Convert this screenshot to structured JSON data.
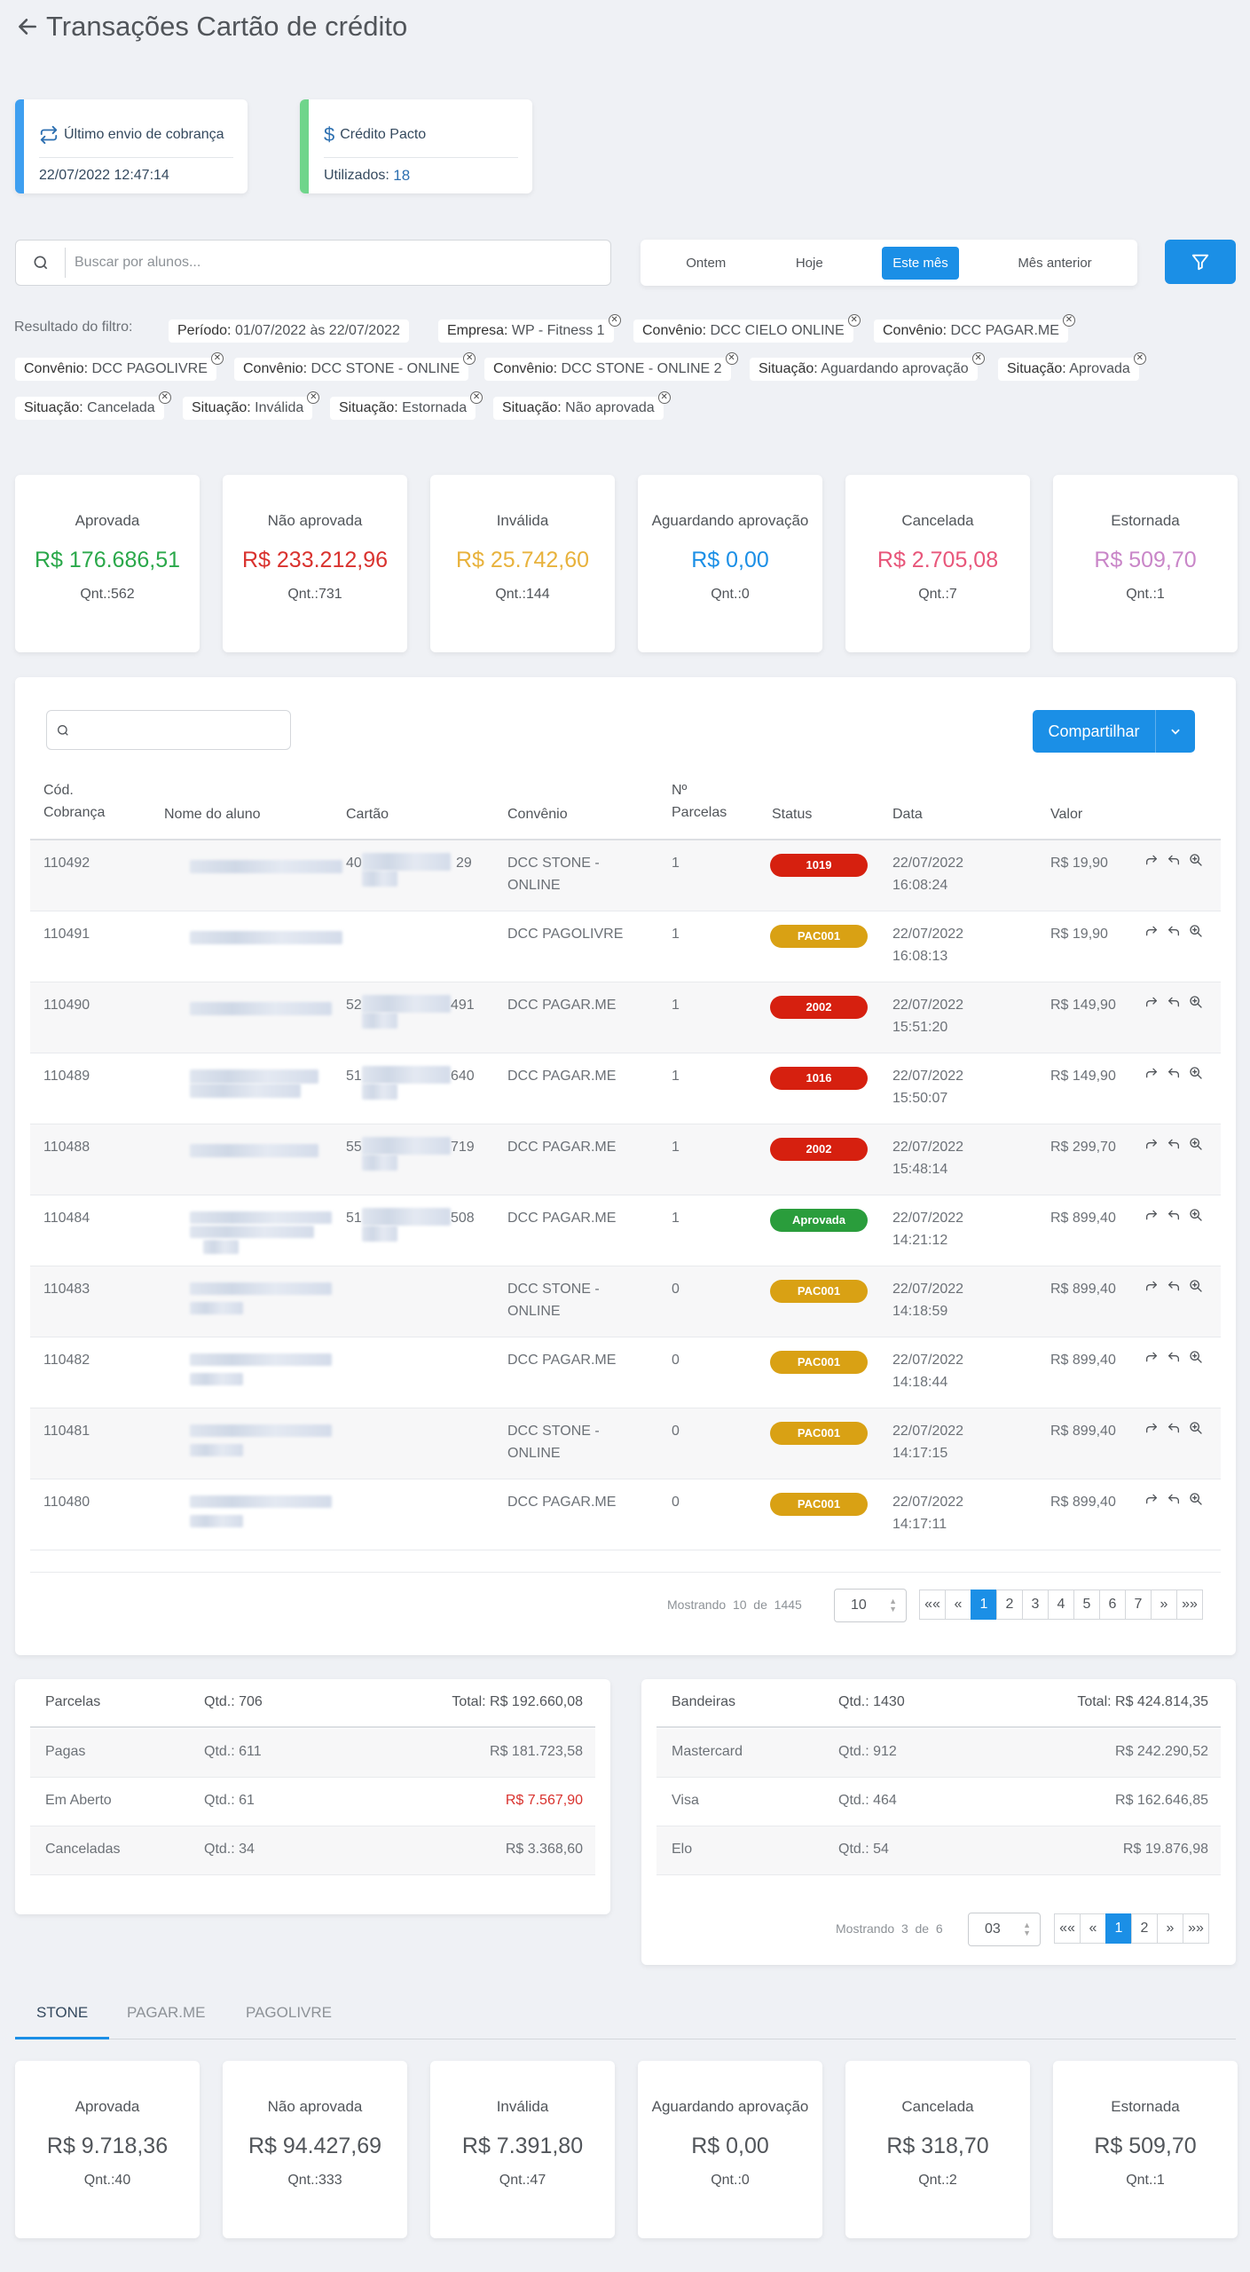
{
  "page": {
    "title": "Transações Cartão de crédito"
  },
  "info_cards": {
    "last_billing": {
      "label": "Último envio de cobrança",
      "value": "22/07/2022 12:47:14"
    },
    "credit": {
      "label": "Crédito Pacto",
      "value_label": "Utilizados:",
      "value": "18"
    }
  },
  "search": {
    "placeholder": "Buscar por alunos..."
  },
  "period": {
    "options": [
      "Ontem",
      "Hoje",
      "Este mês",
      "Mês anterior"
    ],
    "selected": "Este mês"
  },
  "filter": {
    "label": "Resultado do filtro:",
    "chips": [
      {
        "key": "Período:",
        "value": "01/07/2022 às 22/07/2022"
      },
      {
        "key": "Empresa:",
        "value": "WP - Fitness 1"
      },
      {
        "key": "Convênio:",
        "value": "DCC CIELO ONLINE"
      },
      {
        "key": "Convênio:",
        "value": "DCC PAGAR.ME"
      },
      {
        "key": "Convênio:",
        "value": "DCC PAGOLIVRE"
      },
      {
        "key": "Convênio:",
        "value": "DCC STONE - ONLINE"
      },
      {
        "key": "Convênio:",
        "value": "DCC STONE - ONLINE 2"
      },
      {
        "key": "Situação:",
        "value": "Aguardando aprovação"
      },
      {
        "key": "Situação:",
        "value": "Aprovada"
      },
      {
        "key": "Situação:",
        "value": "Cancelada"
      },
      {
        "key": "Situação:",
        "value": "Inválida"
      },
      {
        "key": "Situação:",
        "value": "Estornada"
      },
      {
        "key": "Situação:",
        "value": "Não aprovada"
      }
    ]
  },
  "stats": [
    {
      "label": "Aprovada",
      "value": "R$ 176.686,51",
      "qty": "Qnt.:562",
      "color": "#2aa84a"
    },
    {
      "label": "Não aprovada",
      "value": "R$ 233.212,96",
      "qty": "Qnt.:731",
      "color": "#d9322e"
    },
    {
      "label": "Inválida",
      "value": "R$ 25.742,60",
      "qty": "Qnt.:144",
      "color": "#e8b23c"
    },
    {
      "label": "Aguardando aprovação",
      "value": "R$ 0,00",
      "qty": "Qnt.:0",
      "color": "#1b8fe6"
    },
    {
      "label": "Cancelada",
      "value": "R$ 2.705,08",
      "qty": "Qnt.:7",
      "color": "#e8567a"
    },
    {
      "label": "Estornada",
      "value": "R$ 509,70",
      "qty": "Qnt.:1",
      "color": "#c986c8"
    }
  ],
  "table": {
    "share_label": "Compartilhar",
    "headers": {
      "cod": "Cód.\nCobrança",
      "nome": "Nome do aluno",
      "cartao": "Cartão",
      "convenio": "Convênio",
      "parcelas": "Nº\nParcelas",
      "status": "Status",
      "data": "Data",
      "valor": "Valor"
    },
    "rows": [
      {
        "cod": "110492",
        "cartao_a": "40",
        "cartao_b": "29",
        "convenio": "DCC STONE -\nONLINE",
        "parcelas": "1",
        "status": "1019",
        "status_color": "#d6200f",
        "data": "22/07/2022\n16:08:24",
        "valor": "R$ 19,90"
      },
      {
        "cod": "110491",
        "cartao_a": "",
        "cartao_b": "",
        "convenio": "DCC PAGOLIVRE",
        "parcelas": "1",
        "status": "PAC001",
        "status_color": "#d9a114",
        "data": "22/07/2022\n16:08:13",
        "valor": "R$ 19,90"
      },
      {
        "cod": "110490",
        "cartao_a": "52",
        "cartao_b": "491",
        "convenio": "DCC PAGAR.ME",
        "parcelas": "1",
        "status": "2002",
        "status_color": "#d6200f",
        "data": "22/07/2022\n15:51:20",
        "valor": "R$ 149,90"
      },
      {
        "cod": "110489",
        "cartao_a": "51",
        "cartao_b": "640",
        "convenio": "DCC PAGAR.ME",
        "parcelas": "1",
        "status": "1016",
        "status_color": "#d6200f",
        "data": "22/07/2022\n15:50:07",
        "valor": "R$ 149,90"
      },
      {
        "cod": "110488",
        "cartao_a": "55",
        "cartao_b": "719",
        "convenio": "DCC PAGAR.ME",
        "parcelas": "1",
        "status": "2002",
        "status_color": "#d6200f",
        "data": "22/07/2022\n15:48:14",
        "valor": "R$ 299,70"
      },
      {
        "cod": "110484",
        "cartao_a": "51",
        "cartao_b": "508",
        "convenio": "DCC PAGAR.ME",
        "parcelas": "1",
        "status": "Aprovada",
        "status_color": "#2a9d3c",
        "data": "22/07/2022\n14:21:12",
        "valor": "R$ 899,40"
      },
      {
        "cod": "110483",
        "cartao_a": "",
        "cartao_b": "",
        "convenio": "DCC STONE -\nONLINE",
        "parcelas": "0",
        "status": "PAC001",
        "status_color": "#d9a114",
        "data": "22/07/2022\n14:18:59",
        "valor": "R$ 899,40"
      },
      {
        "cod": "110482",
        "cartao_a": "",
        "cartao_b": "",
        "convenio": "DCC PAGAR.ME",
        "parcelas": "0",
        "status": "PAC001",
        "status_color": "#d9a114",
        "data": "22/07/2022\n14:18:44",
        "valor": "R$ 899,40"
      },
      {
        "cod": "110481",
        "cartao_a": "",
        "cartao_b": "",
        "convenio": "DCC STONE -\nONLINE",
        "parcelas": "0",
        "status": "PAC001",
        "status_color": "#d9a114",
        "data": "22/07/2022\n14:17:15",
        "valor": "R$ 899,40"
      },
      {
        "cod": "110480",
        "cartao_a": "",
        "cartao_b": "",
        "convenio": "DCC PAGAR.ME",
        "parcelas": "0",
        "status": "PAC001",
        "status_color": "#d9a114",
        "data": "22/07/2022\n14:17:11",
        "valor": "R$ 899,40"
      }
    ],
    "pagination": {
      "showing": "Mostrando",
      "count": "10",
      "of": "de",
      "total": "1445",
      "page_size": "10",
      "pages": [
        "««",
        "«",
        "1",
        "2",
        "3",
        "4",
        "5",
        "6",
        "7",
        "»",
        "»»"
      ],
      "current": "1"
    }
  },
  "parcelas": {
    "header": [
      "Parcelas",
      "Qtd.: 706",
      "Total: R$ 192.660,08"
    ],
    "rows": [
      {
        "label": "Pagas",
        "qty": "Qtd.: 611",
        "total": "R$ 181.723,58",
        "color": "#6c7177"
      },
      {
        "label": "Em Aberto",
        "qty": "Qtd.: 61",
        "total": "R$ 7.567,90",
        "color": "#d9322e"
      },
      {
        "label": "Canceladas",
        "qty": "Qtd.: 34",
        "total": "R$ 3.368,60",
        "color": "#6c7177"
      }
    ]
  },
  "bandeiras": {
    "header": [
      "Bandeiras",
      "Qtd.: 1430",
      "Total: R$ 424.814,35"
    ],
    "rows": [
      {
        "label": "Mastercard",
        "qty": "Qtd.: 912",
        "total": "R$ 242.290,52"
      },
      {
        "label": "Visa",
        "qty": "Qtd.: 464",
        "total": "R$ 162.646,85"
      },
      {
        "label": "Elo",
        "qty": "Qtd.: 54",
        "total": "R$ 19.876,98"
      }
    ],
    "pagination": {
      "showing": "Mostrando",
      "count": "3",
      "of": "de",
      "total": "6",
      "page_size": "03",
      "pages": [
        "««",
        "«",
        "1",
        "2",
        "»",
        "»»"
      ],
      "current": "1"
    }
  },
  "gateway_tabs": {
    "items": [
      "STONE",
      "PAGAR.ME",
      "PAGOLIVRE"
    ],
    "active": "STONE"
  },
  "gateway_stats": [
    {
      "label": "Aprovada",
      "value": "R$ 9.718,36",
      "qty": "Qnt.:40"
    },
    {
      "label": "Não aprovada",
      "value": "R$ 94.427,69",
      "qty": "Qnt.:333"
    },
    {
      "label": "Inválida",
      "value": "R$ 7.391,80",
      "qty": "Qnt.:47"
    },
    {
      "label": "Aguardando aprovação",
      "value": "R$ 0,00",
      "qty": "Qnt.:0"
    },
    {
      "label": "Cancelada",
      "value": "R$ 318,70",
      "qty": "Qnt.:2"
    },
    {
      "label": "Estornada",
      "value": "R$ 509,70",
      "qty": "Qnt.:1"
    }
  ]
}
